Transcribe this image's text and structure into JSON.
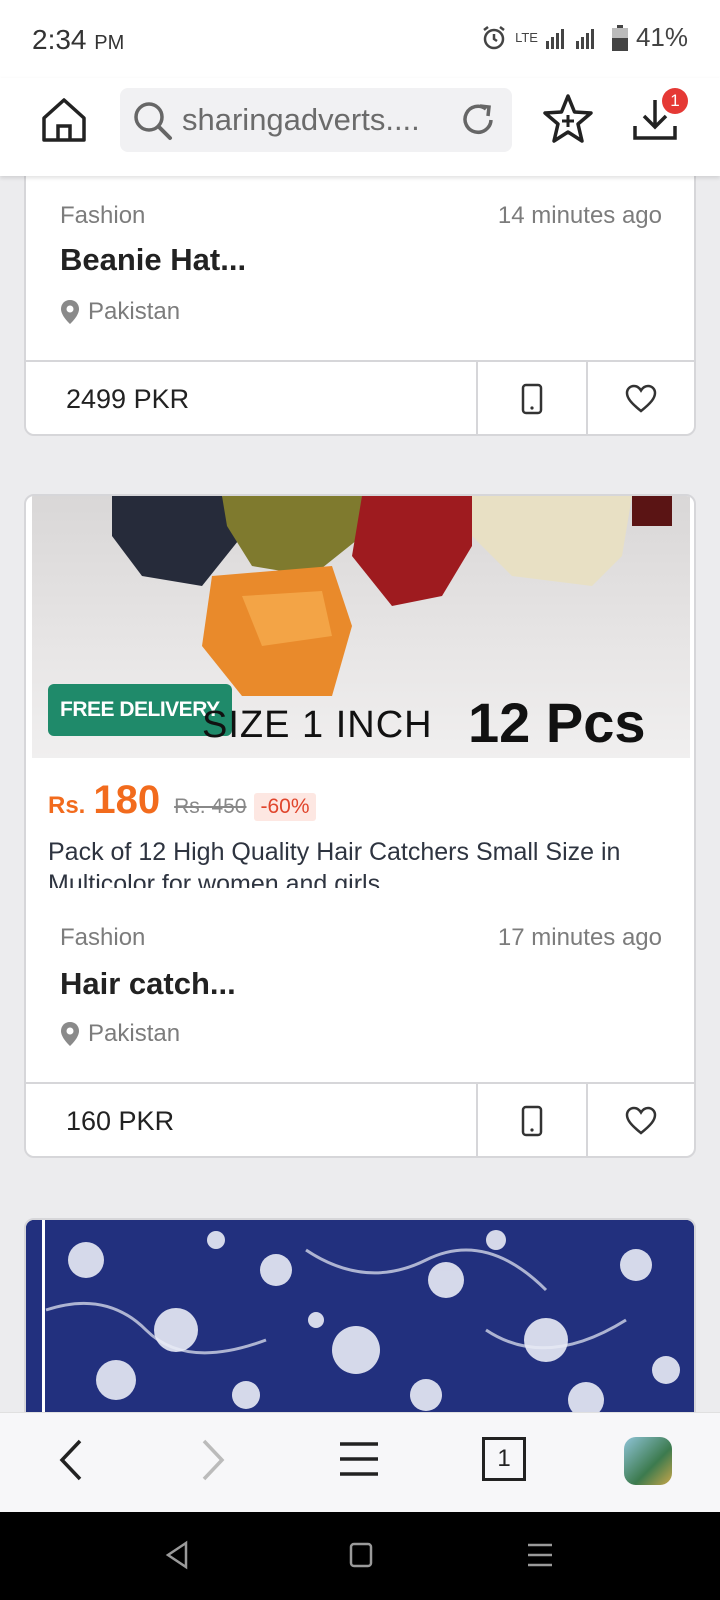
{
  "status": {
    "time": "2:34",
    "ampm": "PM",
    "network": "LTE",
    "battery": "41%"
  },
  "browser": {
    "url_text": "sharingadverts....",
    "downloads_badge": "1",
    "tab_count": "1"
  },
  "card1": {
    "category": "Fashion",
    "posted": "14 minutes ago",
    "title": "Beanie Hat...",
    "location": "Pakistan",
    "price": "2499 PKR"
  },
  "card2": {
    "image_badge": "FREE DELIVERY",
    "image_text_size": "SIZE  1 INCH",
    "image_text_count": "12 Pcs",
    "promo_currency": "Rs.",
    "promo_price": "180",
    "old_price": "Rs. 450",
    "discount": "-60%",
    "description": "Pack of 12 High Quality Hair Catchers Small Size in Multicolor for women and girls",
    "category": "Fashion",
    "posted": "17 minutes ago",
    "title": "Hair catch...",
    "location": "Pakistan",
    "price": "160 PKR"
  },
  "colors": {
    "accent_orange": "#f26b1d",
    "badge_green": "#1f8a6a",
    "notif_red": "#e53935"
  }
}
